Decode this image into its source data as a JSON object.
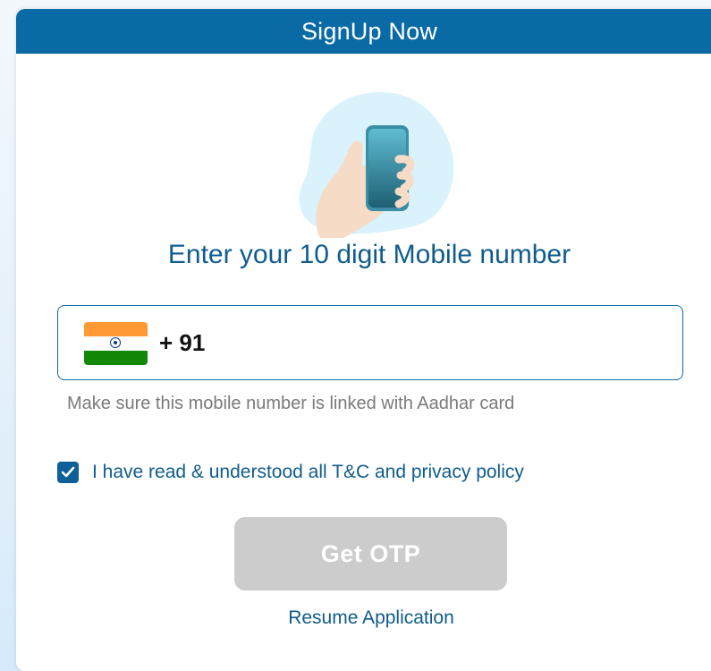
{
  "header": {
    "title": "SignUp Now"
  },
  "illustration": {
    "icon": "hand-holding-phone-icon"
  },
  "form": {
    "headline": "Enter your 10 digit Mobile number",
    "country_flag": "india-flag-icon",
    "country_code": "+ 91",
    "phone_value": "",
    "hint": "Make sure this mobile number is linked with Aadhar card",
    "terms_checked": true,
    "terms_label": "I have read & understood all T&C and privacy policy",
    "submit_label": "Get OTP",
    "resume_label": "Resume Application"
  },
  "colors": {
    "brand": "#0a6aa6",
    "text_primary": "#0f5c8d",
    "button_disabled": "#cccccc"
  }
}
